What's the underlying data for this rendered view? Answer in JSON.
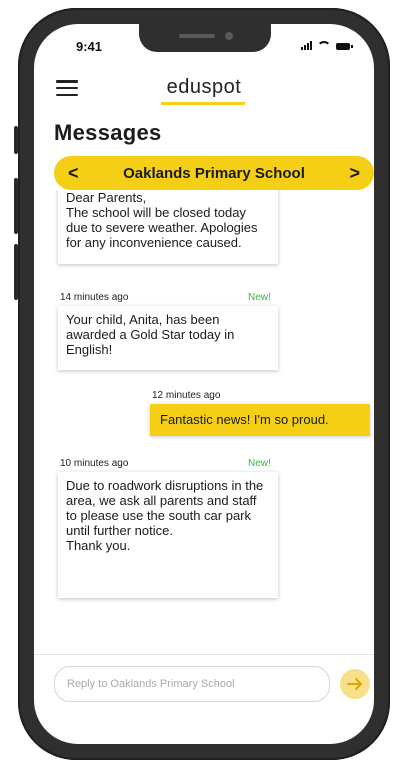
{
  "status": {
    "time": "9:41"
  },
  "header": {
    "brand": "eduspot"
  },
  "page": {
    "title": "Messages"
  },
  "school": {
    "name": "Oaklands Primary School",
    "prev_icon": "<",
    "next_icon": ">"
  },
  "messages": [
    {
      "direction": "incoming",
      "time": "",
      "new": "",
      "text": "Dear Parents,\nThe school will be closed today due to severe weather. Apologies for any inconvenience caused."
    },
    {
      "direction": "incoming",
      "time": "14 minutes ago",
      "new": "New!",
      "text": "Your child, Anita, has been awarded a Gold Star today in English!"
    },
    {
      "direction": "outgoing",
      "time": "12 minutes ago",
      "new": "",
      "text": "Fantastic news! I'm so proud."
    },
    {
      "direction": "incoming",
      "time": "10 minutes ago",
      "new": "New!",
      "text": "Due to roadwork disruptions in the area, we ask all parents and staff to please use the south car park until further notice.\nThank you."
    }
  ],
  "reply": {
    "placeholder": "Reply to Oaklands Primary School"
  },
  "colors": {
    "accent": "#f5cf15",
    "new_badge": "#3ab54a",
    "phone_frame": "#2f2f30"
  },
  "icons": {
    "menu": "hamburger-icon",
    "send": "arrow-right-icon"
  }
}
